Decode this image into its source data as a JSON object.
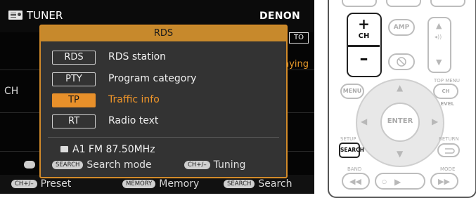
{
  "screen": {
    "app_title": "TUNER",
    "brand": "DENON",
    "bg_auto_fragment": "TO",
    "bg_playing_fragment": "aying",
    "bg_ch_fragment": "CH",
    "bottom_bar": {
      "preset_key": "CH+/–",
      "preset_label": "Preset",
      "memory_key": "MEMORY",
      "memory_label": "Memory",
      "search_key": "SEARCH",
      "search_label": "Search"
    }
  },
  "popup": {
    "title": "RDS",
    "items": [
      {
        "tag": "RDS",
        "label": "RDS station",
        "selected": false
      },
      {
        "tag": "PTY",
        "label": "Program category",
        "selected": false
      },
      {
        "tag": "TP",
        "label": "Traffic info",
        "selected": true
      },
      {
        "tag": "RT",
        "label": "Radio text",
        "selected": false
      }
    ],
    "station": "A1 FM 87.50MHz",
    "footer": {
      "search_key": "SEARCH",
      "search_label": "Search mode",
      "tuning_key": "CH+/–",
      "tuning_label": "Tuning"
    }
  },
  "remote": {
    "amp_label": "AMP",
    "ch_plus": "+",
    "ch_label": "CH",
    "ch_minus": "–",
    "menu_label": "MENU",
    "top_menu_label": "TOP MENU",
    "ch_level_label": "CH LEVEL",
    "enter_label": "ENTER",
    "setup_label": "SETUP",
    "return_label": "RETURN",
    "search_label": "SEARCH",
    "band_label": "BAND",
    "mode_label": "MODE"
  }
}
